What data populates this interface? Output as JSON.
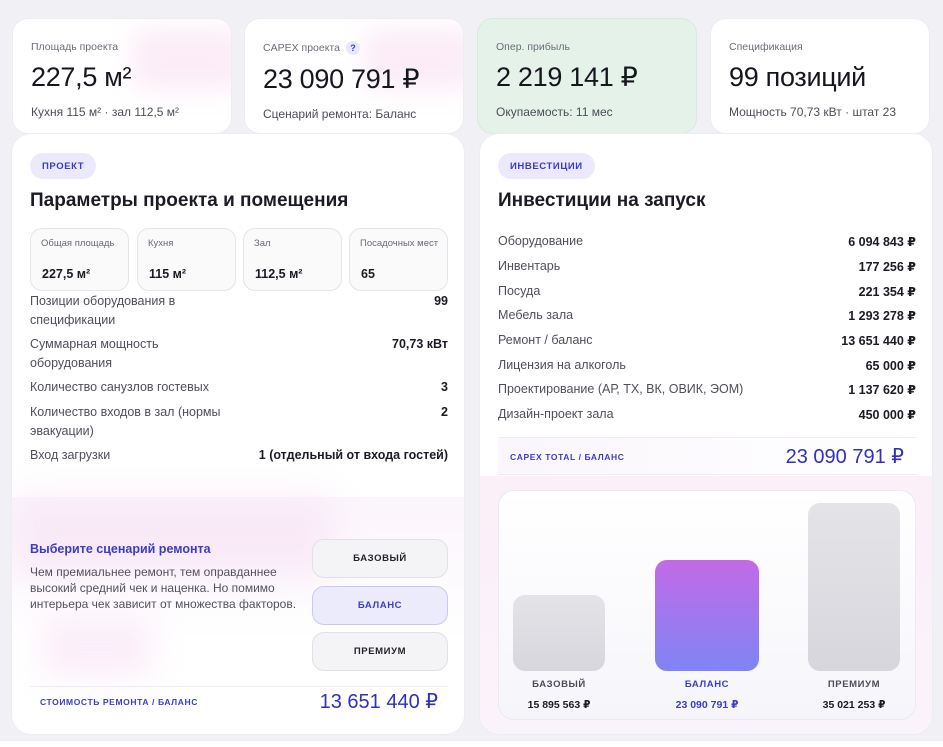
{
  "stats": [
    {
      "label": "Площадь проекта",
      "value": "227,5 м²",
      "sub": "Кухня 115 м² · зал 112,5 м²"
    },
    {
      "label": "CAPEX проекта",
      "help": "?",
      "value": "23 090 791 ₽",
      "sub": "Сценарий ремонта: Баланс"
    },
    {
      "label": "Опер. прибыль",
      "value": "2 219 141 ₽",
      "sub": "Окупаемость: 11 мес"
    },
    {
      "label": "Спецификация",
      "value": "99 позиций",
      "sub": "Мощность 70,73 кВт · штат 23"
    }
  ],
  "project": {
    "tag": "ПРОЕКТ",
    "title": "Параметры проекта и помещения",
    "boxes": [
      {
        "label": "Общая площадь",
        "value": "227,5 м²"
      },
      {
        "label": "Кухня",
        "value": "115 м²"
      },
      {
        "label": "Зал",
        "value": "112,5 м²"
      },
      {
        "label": "Посадочных мест",
        "value": "65"
      }
    ],
    "params": [
      {
        "label": "Позиции оборудования в спецификации",
        "value": "99"
      },
      {
        "label": "Суммарная мощность оборудования",
        "value": "70,73 кВт"
      },
      {
        "label": "Количество санузлов гостевых",
        "value": "3"
      },
      {
        "label": "Количество входов в зал (нормы эвакуации)",
        "value": "2"
      },
      {
        "label": "Вход загрузки",
        "value": "1 (отдельный от входа гостей)"
      }
    ],
    "scenario": {
      "title": "Выберите сценарий ремонта",
      "desc": "Чем премиальнее ремонт, тем оправданнее высокий средний чек и наценка. Но помимо интерьера чек зависит от множества факторов.",
      "buttons": [
        "БАЗОВЫЙ",
        "БАЛАНС",
        "ПРЕМИУМ"
      ],
      "selected": "БАЛАНС"
    },
    "cost_label": "СТОИМОСТЬ РЕМОНТА / БАЛАНС",
    "cost_value": "13 651 440 ₽"
  },
  "investments": {
    "tag": "ИНВЕСТИЦИИ",
    "title": "Инвестиции на запуск",
    "rows": [
      {
        "label": "Оборудование",
        "value": "6 094 843 ₽"
      },
      {
        "label": "Инвентарь",
        "value": "177 256 ₽"
      },
      {
        "label": "Посуда",
        "value": "221 354 ₽"
      },
      {
        "label": "Мебель зала",
        "value": "1 293 278 ₽"
      },
      {
        "label": "Ремонт / баланс",
        "value": "13 651 440 ₽"
      },
      {
        "label": "Лицензия на алкоголь",
        "value": "65 000 ₽"
      },
      {
        "label": "Проектирование (АР, ТХ, ВК, ОВИК, ЭОМ)",
        "value": "1 137 620 ₽"
      },
      {
        "label": "Дизайн-проект зала",
        "value": "450 000 ₽"
      }
    ],
    "capex_label": "CAPEX TOTAL / БАЛАНС",
    "capex_value": "23 090 791 ₽"
  },
  "chart_data": {
    "type": "bar",
    "categories": [
      "БАЗОВЫЙ",
      "БАЛАНС",
      "ПРЕМИУМ"
    ],
    "values": [
      15895563,
      23090791,
      35021253
    ],
    "value_labels": [
      "15 895 563 ₽",
      "23 090 791 ₽",
      "35 021 253 ₽"
    ],
    "active": "БАЛАНС",
    "colors": {
      "inactive": "#d6d6dc",
      "active_top": "#c36ae6",
      "active_bottom": "#7f84f5"
    }
  }
}
